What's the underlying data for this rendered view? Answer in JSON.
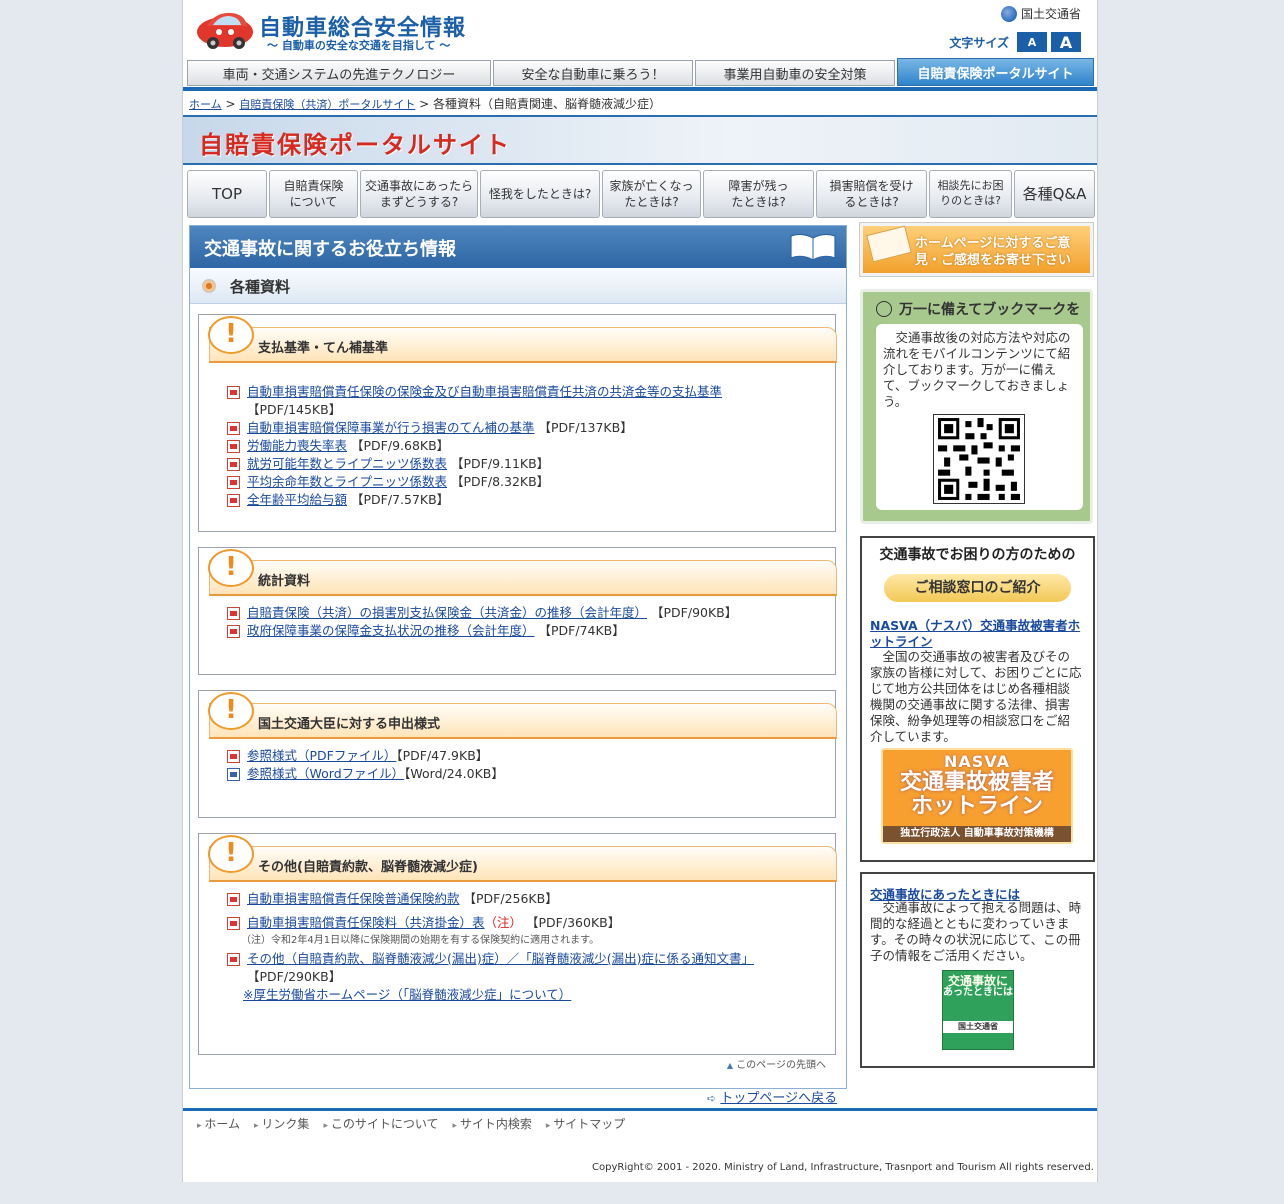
{
  "header": {
    "site_title": "自動車総合安全情報",
    "site_subtitle": "〜 自動車の安全な交通を目指して 〜",
    "ministry": "国土交通省",
    "font_size_label": "文字サイズ",
    "font_small": "A",
    "font_large": "A"
  },
  "top_tabs": [
    {
      "label": "車両・交通システムの先進テクノロジー"
    },
    {
      "label": "安全な自動車に乗ろう！"
    },
    {
      "label": "事業用自動車の安全対策"
    },
    {
      "label": "自賠責保険ポータルサイト"
    }
  ],
  "breadcrumb": {
    "home": "ホーム",
    "portal": "自賠責保険（共済）ポータルサイト",
    "sep1": " > ",
    "sep2": " > ",
    "current": "各種資料（自賠責関連、脳脊髄液減少症）"
  },
  "banner": {
    "title": "自賠責保険ポータルサイト"
  },
  "section_nav": [
    {
      "label": "TOP"
    },
    {
      "label": "自賠責保険について"
    },
    {
      "label": "交通事故にあったらまずどうする?"
    },
    {
      "label": "怪我をしたときは?"
    },
    {
      "label": "家族が亡くなったときは?"
    },
    {
      "label": "障害が残ったときは?"
    },
    {
      "label": "損害賠償を受けるときは?"
    },
    {
      "label": "相談先にお困りのときは?"
    },
    {
      "label": "各種Q&A"
    }
  ],
  "main": {
    "title": "交通事故に関するお役立ち情報",
    "subtitle": "各種資料",
    "sections": [
      {
        "heading": "支払基準・てん補基準",
        "items": [
          {
            "link": "自動車損害賠償責任保険の保険金及び自動車損害賠償責任共済の共済金等の支払基準",
            "size": "【PDF/145KB】"
          },
          {
            "link": "自動車損害賠償保障事業が行う損害のてん補の基準",
            "size": "【PDF/137KB】"
          },
          {
            "link": "労働能力喪失率表",
            "size": "【PDF/9.68KB】"
          },
          {
            "link": "就労可能年数とライプニッツ係数表",
            "size": "【PDF/9.11KB】"
          },
          {
            "link": "平均余命年数とライプニッツ係数表",
            "size": "【PDF/8.32KB】"
          },
          {
            "link": "全年齢平均給与額",
            "size": "【PDF/7.57KB】"
          }
        ]
      },
      {
        "heading": "統計資料",
        "items": [
          {
            "link": "自賠責保険（共済）の損害別支払保険金（共済金）の推移（会計年度）",
            "size": "【PDF/90KB】"
          },
          {
            "link": "政府保障事業の保障金支払状況の推移（会計年度）",
            "size": "【PDF/74KB】"
          }
        ]
      },
      {
        "heading": "国土交通大臣に対する申出様式",
        "items": [
          {
            "link": "参照様式（PDFファイル）",
            "size": "【PDF/47.9KB】"
          },
          {
            "link": "参照様式（Wordファイル）",
            "size": "【Word/24.0KB】"
          }
        ]
      },
      {
        "heading": "その他(自賠責約款、脳脊髄液減少症)",
        "items": [
          {
            "link": "自動車損害賠償責任保険普通保険約款",
            "size": "【PDF/256KB】"
          },
          {
            "link": "自動車損害賠償責任保険料（共済掛金）表",
            "note_mark": "（注）",
            "size": "【PDF/360KB】"
          },
          {
            "link": "その他（自賠責約款、脳脊髄液減少(漏出)症）／「脳脊髄液減少(漏出)症に係る通知文書」",
            "size": "【PDF/290KB】"
          }
        ],
        "note": "（注）令和2年4月1日以降に保険期間の始期を有する保険契約に適用されます。",
        "extra_link": "※厚生労働省ホームページ（「脳脊髄液減少症」について）"
      }
    ],
    "page_top": "このページの先頭へ",
    "back_to_top": "トップページへ戻る"
  },
  "sidebar": {
    "feedback": "ホームページに対するご意見・ご感想をお寄せ下さい",
    "bookmark_title": "万一に備えてブックマークを",
    "bookmark_text": "交通事故後の対応方法や対応の流れをモバイルコンテンツにて紹介しております。万が一に備えて、ブックマークしておきましょう。",
    "consult_title": "交通事故でお困りの方のための",
    "consult_pill": "ご相談窓口のご紹介",
    "consult_link": "NASVA（ナスバ）交通事故被害者ホットライン",
    "consult_text": "全国の交通事故の被害者及びその家族の皆様に対して、お困りごとに応じて地方公共団体をはじめ各種相談機関の交通事故に関する法律、損害保険、紛争処理等の相談窓口をご紹介しています。",
    "nasva_line1": "NASVA",
    "nasva_line2": "交通事故被害者",
    "nasva_line3": "ホットライン",
    "nasva_org": "独立行政法人 自動車事故対策機構",
    "booklet_link": "交通事故にあったときには",
    "booklet_text": "交通事故によって抱える問題は、時間的な経過とともに変わっていきます。その時々の状況に応じて、この冊子の情報をご活用ください。",
    "booklet_cover_title": "交通事故に",
    "booklet_cover_sub": "あったときには",
    "booklet_cover_org": "国土交通省"
  },
  "footer": {
    "nav": [
      "ホーム",
      "リンク集",
      "このサイトについて",
      "サイト内検索",
      "サイトマップ"
    ],
    "copyright": "CopyRight© 2001 - 2020.  Ministry of Land, Infrastructure, Trasnport and Tourism All rights reserved."
  }
}
